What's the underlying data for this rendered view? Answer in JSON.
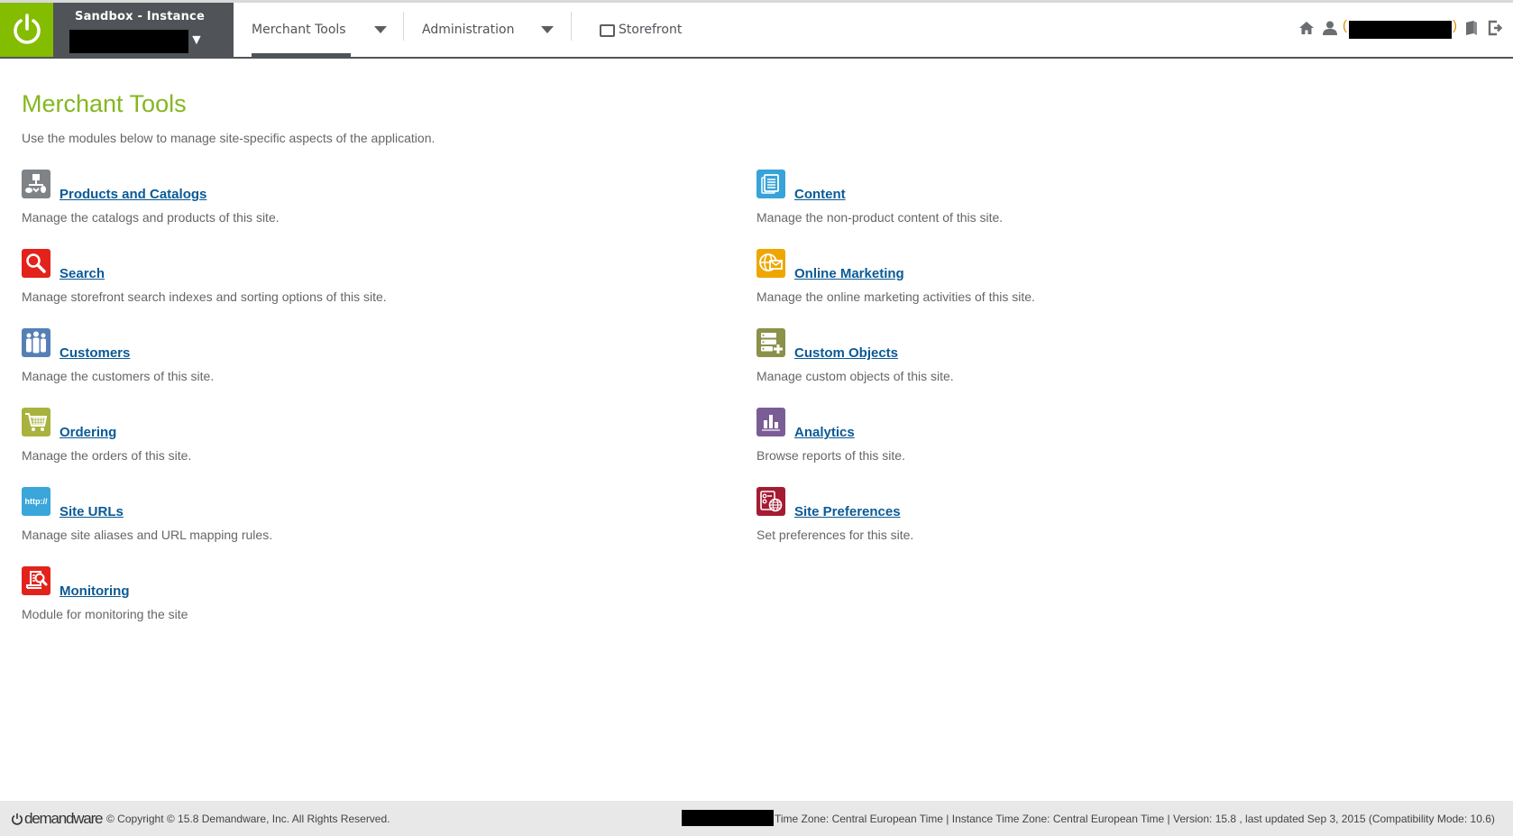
{
  "header": {
    "instance_title": "Sandbox  -  Instance",
    "instance_caret": "▼",
    "nav": [
      {
        "label": "Merchant Tools",
        "active": true,
        "has_dropdown": true
      },
      {
        "label": "Administration",
        "active": false,
        "has_dropdown": true
      },
      {
        "label": "Storefront",
        "active": false,
        "has_dropdown": false,
        "icon": "monitor-icon"
      }
    ],
    "right_icons": [
      "home-icon",
      "user-icon",
      "book-icon",
      "logout-icon"
    ],
    "user_open_paren": "(",
    "user_close_paren": ")"
  },
  "main": {
    "title": "Merchant Tools",
    "description": "Use the modules below to manage site-specific aspects of the application.",
    "modules": [
      {
        "label": "Products and Catalogs",
        "desc": "Manage the catalogs and products of this site.",
        "icon": "products-catalogs-icon",
        "color": "#7f8387"
      },
      {
        "label": "Content",
        "desc": "Manage the non-product content of this site.",
        "icon": "content-icon",
        "color": "#38a3d8"
      },
      {
        "label": "Search",
        "desc": "Manage storefront search indexes and sorting options of this site.",
        "icon": "search-icon",
        "color": "#e3231b"
      },
      {
        "label": "Online Marketing",
        "desc": "Manage the online marketing activities of this site.",
        "icon": "online-marketing-icon",
        "color": "#eea700"
      },
      {
        "label": "Customers",
        "desc": "Manage the customers of this site.",
        "icon": "customers-icon",
        "color": "#5580b5"
      },
      {
        "label": "Custom Objects",
        "desc": "Manage custom objects of this site.",
        "icon": "custom-objects-icon",
        "color": "#8b9148"
      },
      {
        "label": "Ordering",
        "desc": "Manage the orders of this site.",
        "icon": "ordering-icon",
        "color": "#a8b23c"
      },
      {
        "label": "Analytics",
        "desc": "Browse reports of this site.",
        "icon": "analytics-icon",
        "color": "#7b5d96"
      },
      {
        "label": "Site URLs",
        "desc": "Manage site aliases and URL mapping rules.",
        "icon": "site-urls-icon",
        "color": "#3aa6d9",
        "icon_text": "http://"
      },
      {
        "label": "Site Preferences",
        "desc": "Set preferences for this site.",
        "icon": "site-preferences-icon",
        "color": "#a51b33"
      },
      {
        "label": "Monitoring",
        "desc": "Module for monitoring the site",
        "icon": "monitoring-icon",
        "color": "#e3231b"
      }
    ]
  },
  "footer": {
    "logo_text": "demandware",
    "copyright": "© Copyright © 15.8 Demandware, Inc. All Rights Reserved.",
    "info": "Time Zone: Central European Time | Instance Time Zone: Central European Time | Version: 15.8 , last updated Sep 3, 2015 (Compatibility Mode: 10.6)"
  },
  "colors": {
    "brand_green": "#84bd00",
    "header_dark": "#505458",
    "title_green": "#84b71f",
    "link_blue": "#0a5a96",
    "text_grey": "#666666",
    "footer_bg": "#e8e8e8"
  }
}
